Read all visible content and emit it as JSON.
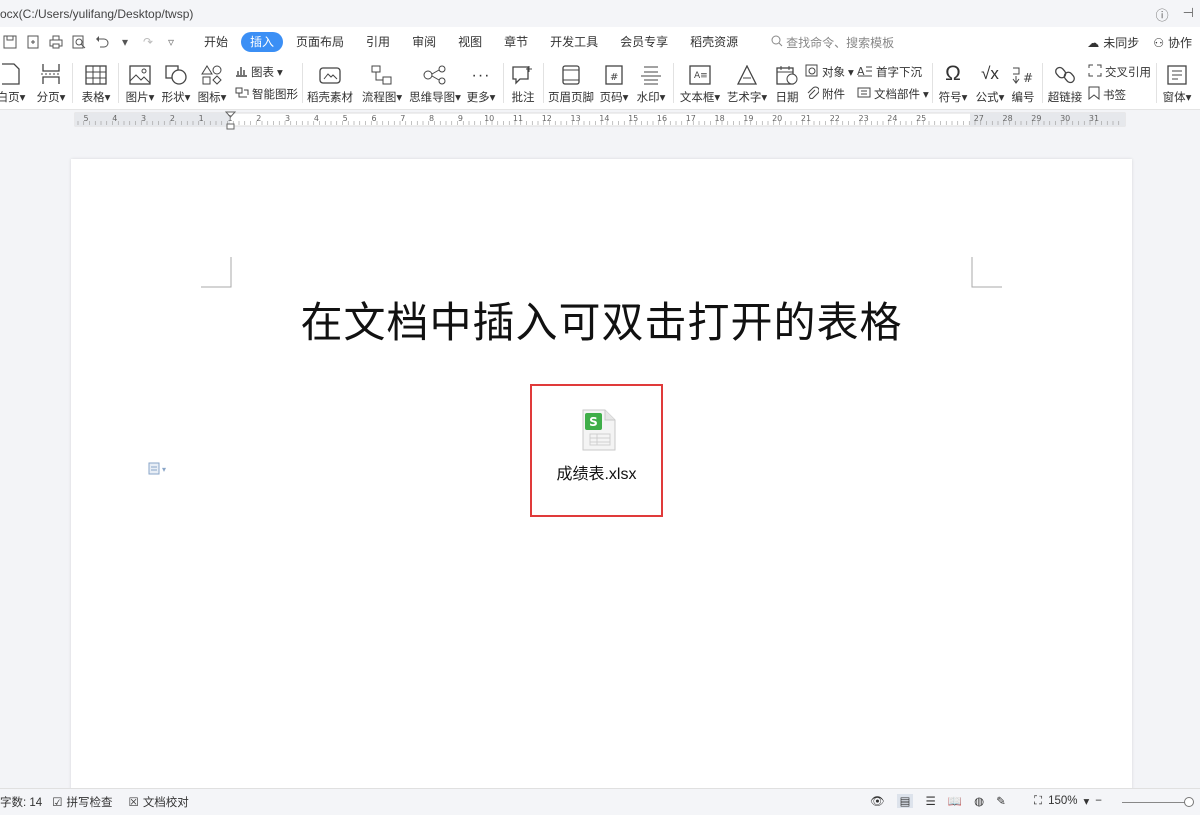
{
  "window": {
    "title": "ocx(C:/Users/yulifang/Desktop/twsp)"
  },
  "tabs": [
    {
      "label": "开始"
    },
    {
      "label": "插入"
    },
    {
      "label": "页面布局"
    },
    {
      "label": "引用"
    },
    {
      "label": "审阅"
    },
    {
      "label": "视图"
    },
    {
      "label": "章节"
    },
    {
      "label": "开发工具"
    },
    {
      "label": "会员专享"
    },
    {
      "label": "稻壳资源"
    }
  ],
  "active_tab": "插入",
  "search": {
    "placeholder": "查找命令、搜索模板"
  },
  "top_right": {
    "sync": "未同步",
    "collab": "协作"
  },
  "ribbon": {
    "blank_page": "白页",
    "page_break": "分页",
    "table": "表格",
    "picture": "图片",
    "shape": "形状",
    "icon": "图标",
    "chart": "图表",
    "smart_art": "智能图形",
    "docer_material": "稻壳素材",
    "flowchart": "流程图",
    "mindmap": "思维导图",
    "more": "更多",
    "comment": "批注",
    "header_footer": "页眉页脚",
    "page_number": "页码",
    "watermark": "水印",
    "textbox": "文本框",
    "wordart": "艺术字",
    "date": "日期",
    "object": "对象",
    "attachment": "附件",
    "drop_cap": "首字下沉",
    "doc_parts": "文档部件",
    "symbol": "符号",
    "formula": "公式",
    "numbering": "编号",
    "hyperlink": "超链接",
    "cross_ref": "交叉引用",
    "bookmark": "书签",
    "window": "窗体"
  },
  "ruler": {
    "labels": [
      "5",
      "4",
      "3",
      "2",
      "1",
      "1",
      "2",
      "3",
      "4",
      "5",
      "6",
      "7",
      "8",
      "9",
      "10",
      "11",
      "12",
      "13",
      "14",
      "15",
      "16",
      "17",
      "18",
      "19",
      "20",
      "21",
      "22",
      "23",
      "24",
      "25",
      "27",
      "28",
      "29",
      "30",
      "31"
    ]
  },
  "document": {
    "title": "在文档中插入可双击打开的表格",
    "embedded_file": {
      "name": "成绩表.xlsx",
      "icon_letter": "S"
    }
  },
  "status": {
    "word_count": "字数: 14",
    "spell_check": "拼写检查",
    "doc_proof": "文档校对",
    "zoom": "150%"
  },
  "colors": {
    "accent": "#3b8ff5",
    "highlight_border": "#e03a3a",
    "xlsx_green": "#3fae49"
  }
}
